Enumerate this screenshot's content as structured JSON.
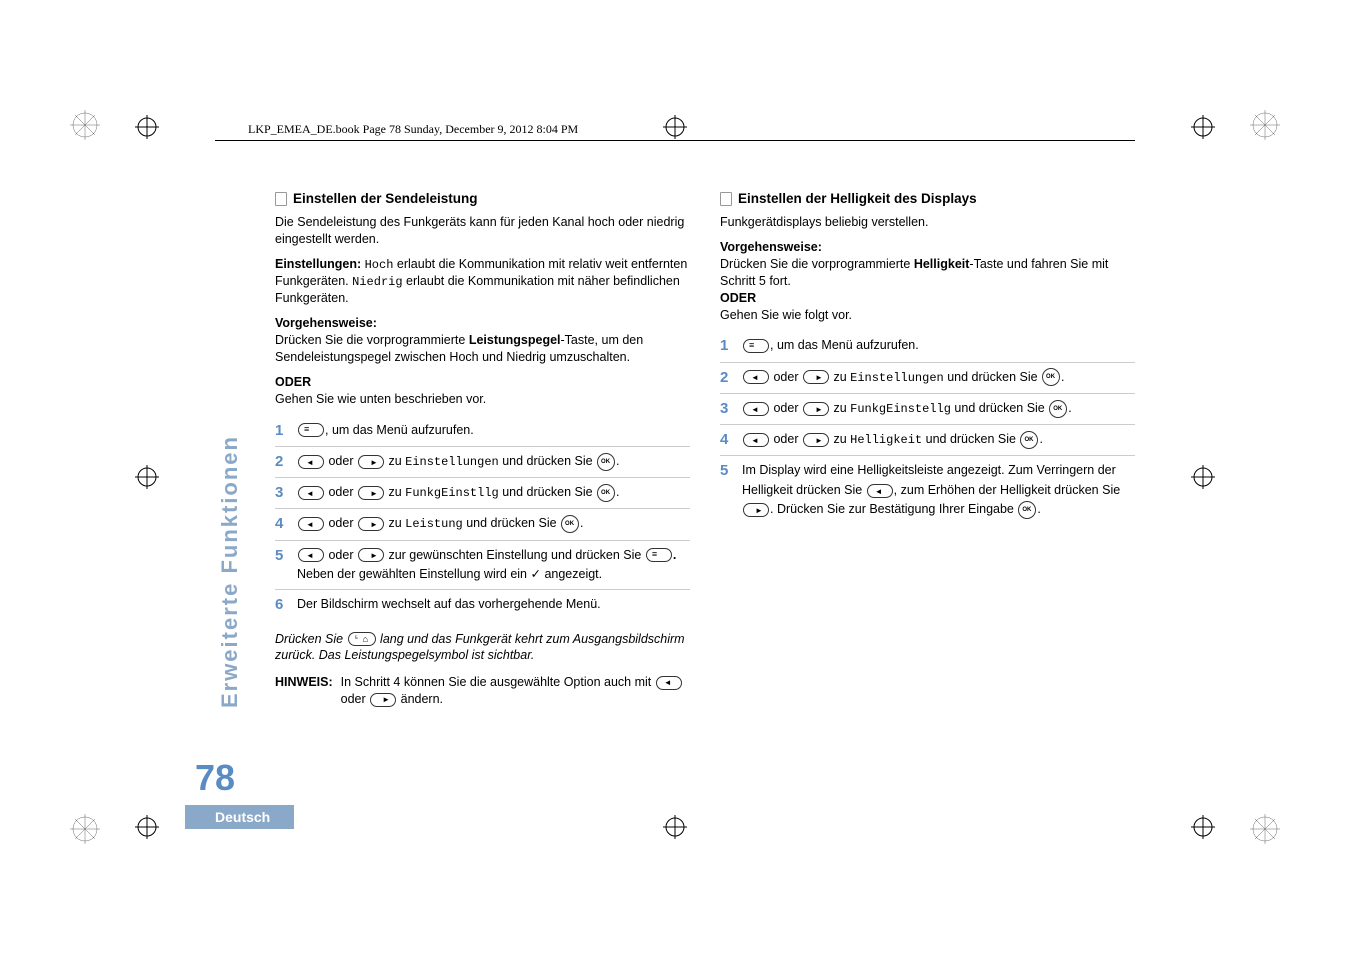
{
  "header": {
    "book_info": "LKP_EMEA_DE.book  Page 78  Sunday, December 9, 2012  8:04 PM"
  },
  "sidebar": {
    "category": "Erweiterte Funktionen"
  },
  "left": {
    "heading": "Einstellen der Sendeleistung",
    "p1": "Die Sendeleistung des Funkgeräts kann für jeden Kanal hoch oder niedrig eingestellt werden.",
    "settings_label": "Einstellungen:",
    "settings_hoch": "Hoch",
    "settings_text1": " erlaubt die Kommunikation mit relativ weit entfernten Funkgeräten. ",
    "settings_niedrig": "Niedrig",
    "settings_text2": " erlaubt die Kommunikation mit näher befindlichen Funkgeräten.",
    "procedure_label": "Vorgehensweise:",
    "procedure_text1": "Drücken Sie die vorprogrammierte ",
    "procedure_bold": "Leistungspegel",
    "procedure_text2": "-Taste, um den Sendeleistungspegel zwischen Hoch und Niedrig umzuschalten.",
    "oder": "ODER",
    "oder_text": "Gehen Sie wie unten beschrieben vor.",
    "steps": {
      "s1": ", um das Menü aufzurufen.",
      "s2_oder": " oder ",
      "s2_zu": " zu ",
      "s2_item": "Einstellungen",
      "s2_end": " und drücken Sie ",
      "s3_item": "FunkgEinstllg",
      "s3_end": " und drücken Sie ",
      "s4_item": "Leistung",
      "s4_end": " und drücken Sie ",
      "s5_text": " zur gewünschten Einstellung und drücken Sie ",
      "s5_text2": " Neben der gewählten Einstellung wird ein ",
      "s5_text3": " angezeigt.",
      "s6": "Der Bildschirm wechselt auf das vorhergehende Menü."
    },
    "italic1": "Drücken Sie ",
    "italic2": " lang und das Funkgerät kehrt zum Ausgangsbildschirm zurück. Das Leistungspegelsymbol ist sichtbar.",
    "note_label": "HINWEIS:",
    "note_text1": "In Schritt 4 können Sie die ausgewählte Option auch mit ",
    "note_oder": " oder ",
    "note_text2": " ändern."
  },
  "right": {
    "heading": "Einstellen der Helligkeit des Displays",
    "p1": "Funkgerätdisplays beliebig verstellen.",
    "procedure_label": "Vorgehensweise:",
    "procedure_text1": "Drücken Sie die vorprogrammierte ",
    "procedure_bold": "Helligkeit",
    "procedure_text2": "-Taste und fahren Sie mit Schritt 5 fort.",
    "oder": "ODER",
    "oder_text": "Gehen Sie wie folgt vor.",
    "steps": {
      "s1": ", um das Menü aufzurufen.",
      "s2_oder": " oder ",
      "s2_zu": " zu ",
      "s2_item": "Einstellungen",
      "s2_end": " und drücken Sie ",
      "s3_item": "FunkgEinstellg",
      "s3_end": " und drücken Sie ",
      "s4_item": "Helligkeit",
      "s4_end": " und drücken Sie ",
      "s5_text1": "Im Display wird eine Helligkeitsleiste angezeigt. Zum Verringern der Helligkeit drücken Sie ",
      "s5_text2": ", zum Erhöhen der Helligkeit drücken Sie ",
      "s5_text3": ". Drücken Sie zur Bestätigung Ihrer Eingabe ",
      "s5_text4": "."
    }
  },
  "footer": {
    "page_number": "78",
    "language": "Deutsch"
  }
}
